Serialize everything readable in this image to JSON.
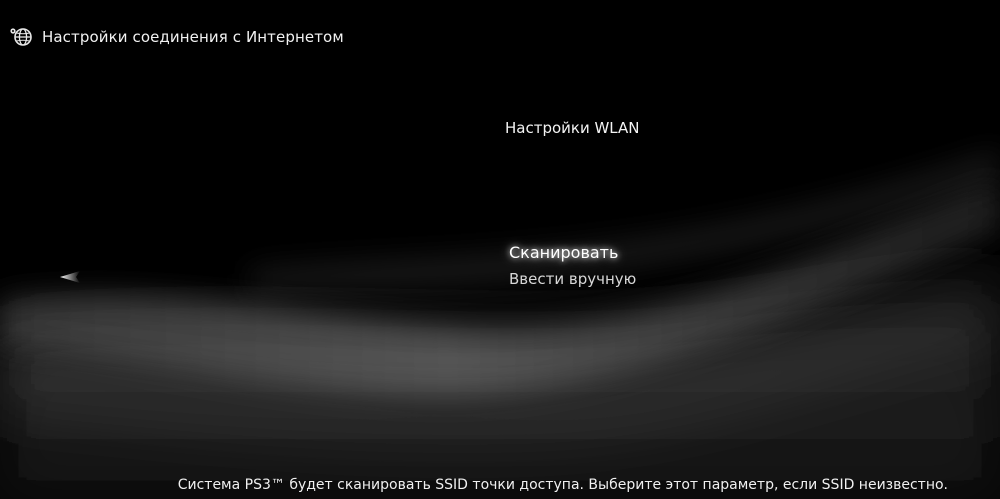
{
  "header": {
    "title": "Настройки соединения с Интернетом",
    "icon": "network-globe-icon"
  },
  "section": {
    "title": "Настройки WLAN"
  },
  "menu": {
    "items": [
      {
        "label": "Сканировать",
        "selected": true
      },
      {
        "label": "Ввести вручную",
        "selected": false
      }
    ]
  },
  "footer": {
    "hint": "Система PS3™ будет сканировать SSID точки доступа. Выберите этот параметр, если SSID неизвестно."
  },
  "colors": {
    "background": "#000000",
    "text": "#e8e8e8",
    "selected_glow": "#ffffff"
  }
}
